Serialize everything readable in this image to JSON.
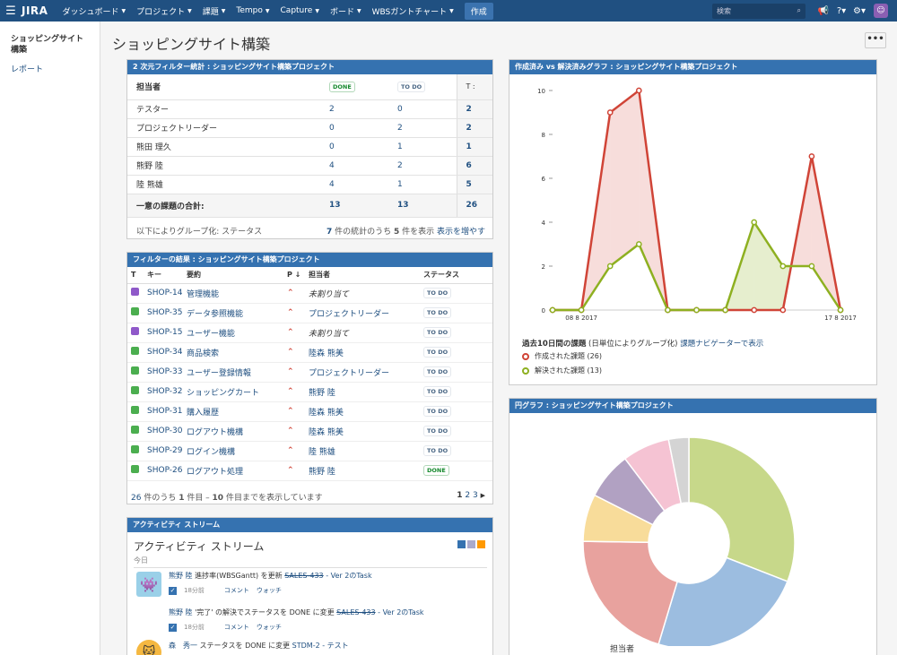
{
  "nav": {
    "logo": "JIRA",
    "menu": [
      "ダッシュボード",
      "プロジェクト",
      "課題",
      "Tempo",
      "Capture",
      "ボード",
      "WBSガントチャート"
    ],
    "create": "作成",
    "search_placeholder": "検索"
  },
  "sidebar": {
    "title": "ショッピングサイト構築",
    "link": "レポート"
  },
  "page_title": "ショッピングサイト構築",
  "twodim": {
    "head": "2 次元フィルター統計 : ショッピングサイト構築プロジェクト",
    "col_assignee": "担当者",
    "col_done": "DONE",
    "col_todo": "TO DO",
    "col_total": "T :",
    "rows": [
      {
        "name": "テスター",
        "done": "2",
        "todo": "0",
        "total": "2"
      },
      {
        "name": "プロジェクトリーダー",
        "done": "0",
        "todo": "2",
        "total": "2"
      },
      {
        "name": "熊田 理久",
        "done": "0",
        "todo": "1",
        "total": "1"
      },
      {
        "name": "熊野 陸",
        "done": "4",
        "todo": "2",
        "total": "6"
      },
      {
        "name": "陸 熊雄",
        "done": "4",
        "todo": "1",
        "total": "5"
      }
    ],
    "total_label": "一意の課題の合計:",
    "total_done": "13",
    "total_todo": "13",
    "total_total": "26",
    "footer_left": "以下によりグループ化: ステータス",
    "footer_n1": "7",
    "footer_mid": " 件の統計のうち ",
    "footer_n2": "5",
    "footer_mid2": " 件を表示 ",
    "footer_more": "表示を増やす"
  },
  "filter": {
    "head": "フィルターの結果 : ショッピングサイト構築プロジェクト",
    "cols": {
      "t": "T",
      "key": "キー",
      "summary": "要約",
      "p": "P ↓",
      "assignee": "担当者",
      "status": "ステータス"
    },
    "rows": [
      {
        "type": "sub",
        "key": "SHOP-14",
        "summary": "管理機能",
        "assignee": "未割り当て",
        "unassigned": true,
        "status": "TO DO"
      },
      {
        "type": "task",
        "key": "SHOP-35",
        "summary": "データ参照機能",
        "assignee": "プロジェクトリーダー",
        "status": "TO DO"
      },
      {
        "type": "sub",
        "key": "SHOP-15",
        "summary": "ユーザー機能",
        "assignee": "未割り当て",
        "unassigned": true,
        "status": "TO DO"
      },
      {
        "type": "task",
        "key": "SHOP-34",
        "summary": "商品検索",
        "assignee": "陸森 熊美",
        "status": "TO DO"
      },
      {
        "type": "task",
        "key": "SHOP-33",
        "summary": "ユーザー登録情報",
        "assignee": "プロジェクトリーダー",
        "status": "TO DO"
      },
      {
        "type": "task",
        "key": "SHOP-32",
        "summary": "ショッピングカート",
        "assignee": "熊野 陸",
        "status": "TO DO"
      },
      {
        "type": "task",
        "key": "SHOP-31",
        "summary": "購入履歴",
        "assignee": "陸森 熊美",
        "status": "TO DO"
      },
      {
        "type": "task",
        "key": "SHOP-30",
        "summary": "ログアウト機構",
        "assignee": "陸森 熊美",
        "status": "TO DO"
      },
      {
        "type": "task",
        "key": "SHOP-29",
        "summary": "ログイン機構",
        "assignee": "陸 熊雄",
        "status": "TO DO"
      },
      {
        "type": "task",
        "key": "SHOP-26",
        "summary": "ログアウト処理",
        "assignee": "熊野 陸",
        "status": "DONE"
      }
    ],
    "footer_total": "26",
    "footer_a": " 件のうち ",
    "footer_first": "1",
    "footer_b": " 件目 – ",
    "footer_last": "10",
    "footer_c": " 件目までを表示しています",
    "pages": [
      "1",
      "2",
      "3"
    ],
    "next": "▶"
  },
  "activity": {
    "head": "アクティビティ ストリーム",
    "title": "アクティビティ ストリーム",
    "today": "今日",
    "items": [
      {
        "user": "熊野 陸",
        "text": " 進捗率(WBSGantt) を更新 ",
        "issue": "SALES-433",
        "issue_rest": " - Ver 2のTask",
        "time": "18分前",
        "comment": "コメント",
        "watch": "ウォッチ"
      },
      {
        "user": "熊野 陸",
        "text": " '完了' の解決でステータスを DONE に変更 ",
        "issue": "SALES-433",
        "issue_rest": " - Ver 2のTask",
        "time": "18分前",
        "comment": "コメント",
        "watch": "ウォッチ"
      },
      {
        "user": "森　秀一",
        "text": " ステータスを DONE に変更 ",
        "issue": "STDM-2",
        "issue_rest": " - テスト"
      }
    ]
  },
  "created_resolved": {
    "head": "作成済み vs 解決済みグラフ : ショッピングサイト構築プロジェクト",
    "legend_title_bold": "過去10日間の課題",
    "legend_title_rest": " (日単位によりグループ化) ",
    "legend_link": "課題ナビゲーターで表示",
    "series_created": "作成された課題 (26)",
    "series_resolved": "解決された課題 (13)"
  },
  "pie": {
    "head": "円グラフ : ショッピングサイト構築プロジェクト",
    "label": "担当者"
  },
  "colors": {
    "created": "#d04437",
    "resolved": "#8eb021",
    "nav": "#205081",
    "head": "#3572b0"
  },
  "chart_data": [
    {
      "type": "line",
      "x": [
        0,
        1,
        2,
        3,
        4,
        5,
        6,
        7,
        8,
        9,
        10
      ],
      "x_tick_labels": [
        {
          "index": 1,
          "label": "08 8 2017"
        },
        {
          "index": 10,
          "label": "17 8 2017"
        }
      ],
      "series": [
        {
          "name": "作成された課題 (26)",
          "values": [
            0,
            0,
            9,
            10,
            0,
            0,
            0,
            0,
            0,
            7,
            0
          ]
        },
        {
          "name": "解決された課題 (13)",
          "values": [
            0,
            0,
            2,
            3,
            0,
            0,
            0,
            4,
            2,
            2,
            0
          ]
        }
      ],
      "ylim": [
        0,
        10
      ],
      "yticks": [
        0,
        2,
        4,
        6,
        8,
        10
      ]
    },
    {
      "type": "pie",
      "values": [
        30,
        23,
        20,
        7,
        7,
        7,
        3
      ],
      "colors": [
        "#c7d88a",
        "#9cbde0",
        "#e8a29e",
        "#f8dc9a",
        "#b1a1c2",
        "#f5c3d3",
        "#d4d4d4"
      ],
      "donut": true
    }
  ]
}
